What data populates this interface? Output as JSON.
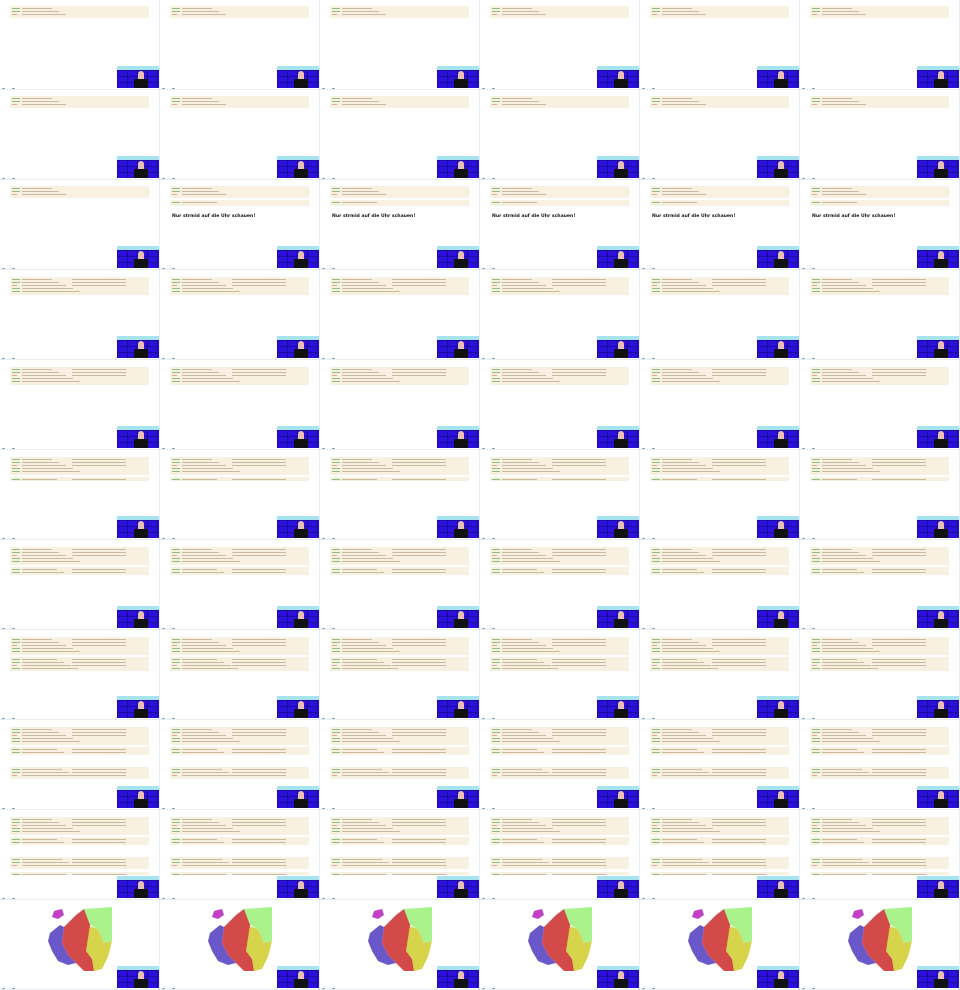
{
  "caption_text": "Nur strmid auf die Uhr schauen!",
  "footer": {
    "left_label": "",
    "right_label": ""
  },
  "colors": {
    "code_bg": "#f8f1e1",
    "video_bg": "#2a10d8",
    "video_top": "#a7e4f2",
    "map_green": "#a9f28c",
    "map_yellow": "#d6d44a",
    "map_red": "#d24b48",
    "map_blue": "#6a58c8",
    "map_magenta": "#c040c8"
  },
  "frames": [
    "code-a",
    "code-a",
    "code-a",
    "code-a",
    "code-a",
    "code-a",
    "code-a",
    "code-a",
    "code-a",
    "code-a",
    "code-a",
    "code-a",
    "code-a",
    "code-b",
    "code-b",
    "code-b",
    "code-b",
    "code-b",
    "code-c",
    "code-c",
    "code-c",
    "code-c",
    "code-c",
    "code-c",
    "code-c",
    "code-c",
    "code-c",
    "code-c",
    "code-c",
    "code-c",
    "code-d",
    "code-d",
    "code-d",
    "code-d",
    "code-d",
    "code-d",
    "code-e",
    "code-e",
    "code-e",
    "code-e",
    "code-e",
    "code-e",
    "code-f",
    "code-f",
    "code-f",
    "code-f",
    "code-f",
    "code-f",
    "code-g",
    "code-g",
    "code-g",
    "code-g",
    "code-g",
    "code-g",
    "code-h",
    "code-h",
    "code-h",
    "code-h",
    "code-h",
    "code-h",
    "map",
    "map",
    "map",
    "map",
    "map",
    "map"
  ],
  "caption_frames": [
    13,
    14,
    15,
    16,
    17
  ]
}
